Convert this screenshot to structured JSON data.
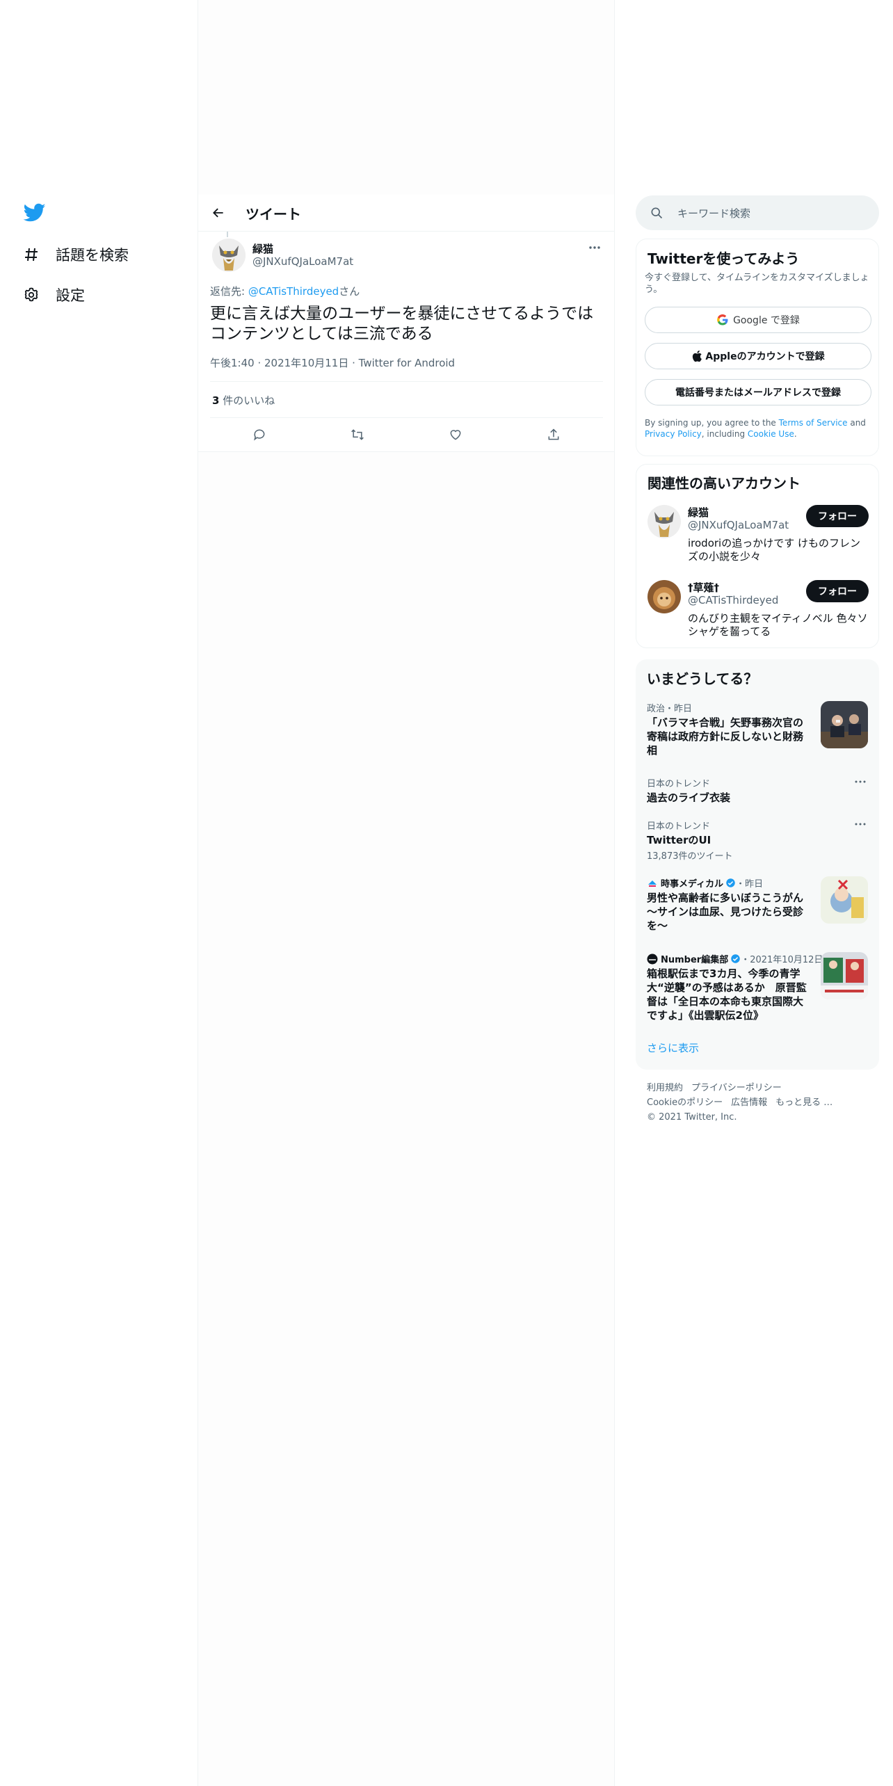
{
  "nav": {
    "logo": "twitter-bird-icon",
    "items": [
      {
        "label": "話題を検索",
        "icon": "hashtag-icon"
      },
      {
        "label": "設定",
        "icon": "gear-icon"
      }
    ]
  },
  "header": {
    "title": "ツイート"
  },
  "tweet": {
    "author_name": "緑猫",
    "author_handle": "@JNXufQJaLoaM7at",
    "reply_prefix": "返信先: ",
    "reply_to": "@CATisThirdeyed",
    "reply_suffix": "さん",
    "text": "更に言えば大量のユーザーを暴徒にさせてるようではコンテンツとしては三流である",
    "meta": "午後1:40 · 2021年10月11日 · Twitter for Android",
    "likes_count": "3",
    "likes_label": " 件のいいね"
  },
  "search": {
    "placeholder": "キーワード検索"
  },
  "signup": {
    "title": "Twitterを使ってみよう",
    "subtitle": "今すぐ登録して、タイムラインをカスタマイズしましょう。",
    "google": "Google で登録",
    "apple": "Appleのアカウントで登録",
    "phone": "電話番号またはメールアドレスで登録",
    "legal_1": "By signing up, you agree to the ",
    "terms": "Terms of Service",
    "legal_2": " and ",
    "privacy": "Privacy Policy",
    "legal_3": ", including ",
    "cookie": "Cookie Use",
    "legal_4": "."
  },
  "related": {
    "title": "関連性の高いアカウント",
    "accounts": [
      {
        "name": "緑猫",
        "handle": "@JNXufQJaLoaM7at",
        "bio": "irodoriの追っかけです けものフレンズの小説を少々",
        "follow": "フォロー"
      },
      {
        "name": "†草薙†",
        "handle": "@CATisThirdeyed",
        "bio": "のんびり主観をマイティノベル 色々ソシャゲを齧ってる",
        "follow": "フォロー"
      }
    ]
  },
  "trends": {
    "title": "いまどうしてる？",
    "items": [
      {
        "category": "政治・昨日",
        "title": "「バラマキ合戦」矢野事務次官の寄稿は政府方針に反しないと財務相"
      },
      {
        "category": "日本のトレンド",
        "title": "過去のライブ衣装"
      },
      {
        "category": "日本のトレンド",
        "title": "TwitterのUI",
        "count": "13,873件のツイート"
      },
      {
        "source": "時事メディカル",
        "time": "・昨日",
        "title": "男性や高齢者に多いぼうこうがん～サインは血尿、見つけたら受診を～"
      },
      {
        "source": "Number編集部",
        "time": "・2021年10月12日",
        "title": "箱根駅伝まで3カ月、今季の青学大“逆襲”の予感はあるか　原晋監督は「全日本の本命も東京国際大ですよ」《出雲駅伝2位》"
      }
    ],
    "show_more": "さらに表示"
  },
  "footer": {
    "links": [
      "利用規約",
      "プライバシーポリシー",
      "Cookieのポリシー",
      "広告情報",
      "もっと見る …"
    ],
    "copyright": "© 2021 Twitter, Inc."
  },
  "colors": {
    "accent": "#1d9bf0",
    "text": "#0f1419",
    "secondary": "#536471",
    "border": "#eff3f4"
  }
}
